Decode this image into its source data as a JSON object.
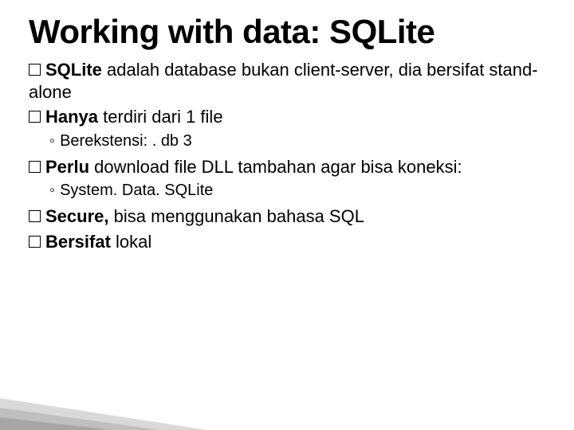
{
  "title": "Working with data: SQLite",
  "bullets": [
    {
      "lead": "SQLite",
      "rest": " adalah database bukan client-server, dia bersifat stand-alone"
    },
    {
      "lead": "Hanya",
      "rest": " terdiri dari 1 file"
    }
  ],
  "sub1": "Berekstensi: . db 3",
  "bullets2": [
    {
      "lead": "Perlu",
      "rest": " download file DLL tambahan agar bisa koneksi:"
    }
  ],
  "sub2": "System. Data. SQLite",
  "bullets3": [
    {
      "lead": "Secure,",
      "rest": " bisa menggunakan bahasa SQL"
    },
    {
      "lead": "Bersifat",
      "rest": " lokal"
    }
  ]
}
